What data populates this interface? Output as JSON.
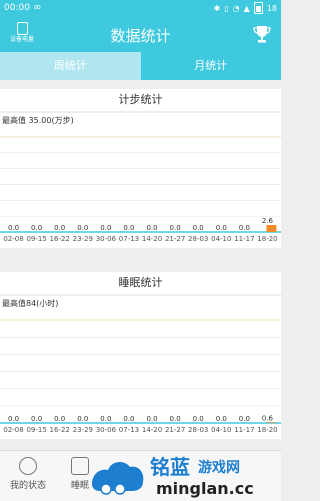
{
  "status_bar": {
    "time": "00:00",
    "battery": "18"
  },
  "header": {
    "title": "数据统计",
    "device_label": "设备电量"
  },
  "tabs": [
    {
      "label": "周统计",
      "active": true
    },
    {
      "label": "月统计",
      "active": false
    }
  ],
  "charts": {
    "steps_title": "计步统计",
    "sleep_title": "睡眠统计"
  },
  "chart_data": [
    {
      "type": "bar",
      "title": "计步统计",
      "max_label": "最高值  35.00(万步)",
      "categories": [
        "02-08",
        "09-15",
        "16-22",
        "23-29",
        "30-06",
        "07-13",
        "14-20",
        "21-27",
        "28-03",
        "04-10",
        "11-17",
        "18-20"
      ],
      "values": [
        0.0,
        0.0,
        0.0,
        0.0,
        0.0,
        0.0,
        0.0,
        0.0,
        0.0,
        0.0,
        0.0,
        2.6
      ],
      "value_labels": [
        "0.0",
        "0.0",
        "0.0",
        "0.0",
        "0.0",
        "0.0",
        "0.0",
        "0.0",
        "0.0",
        "0.0",
        "0.0",
        "2.6"
      ],
      "ylim": [
        0,
        35
      ],
      "bar_color": "#f08c2a",
      "axis_color": "#3ec9de"
    },
    {
      "type": "bar",
      "title": "睡眠统计",
      "max_label": "最高值84(小时)",
      "categories": [
        "02-08",
        "09-15",
        "16-22",
        "23-29",
        "30-06",
        "07-13",
        "14-20",
        "21-27",
        "28-03",
        "04-10",
        "11-17",
        "18-20"
      ],
      "values": [
        0.0,
        0.0,
        0.0,
        0.0,
        0.0,
        0.0,
        0.0,
        0.0,
        0.0,
        0.0,
        0.0,
        0.6
      ],
      "value_labels": [
        "0.0",
        "0.0",
        "0.0",
        "0.0",
        "0.0",
        "0.0",
        "0.0",
        "0.0",
        "0.0",
        "0.0",
        "0.0",
        "0.6"
      ],
      "ylim": [
        0,
        84
      ],
      "bar_color": "#f08c2a",
      "axis_color": "#3ec9de"
    }
  ],
  "bottom_nav": [
    {
      "label": "我的状态"
    },
    {
      "label": "睡眠"
    }
  ],
  "watermark": {
    "brand": "铭蓝",
    "tagline": "游戏网",
    "url": "minglan.cc"
  },
  "colors": {
    "primary": "#3ec9de",
    "tab_active": "#b0e6ef",
    "bar": "#f08c2a"
  }
}
